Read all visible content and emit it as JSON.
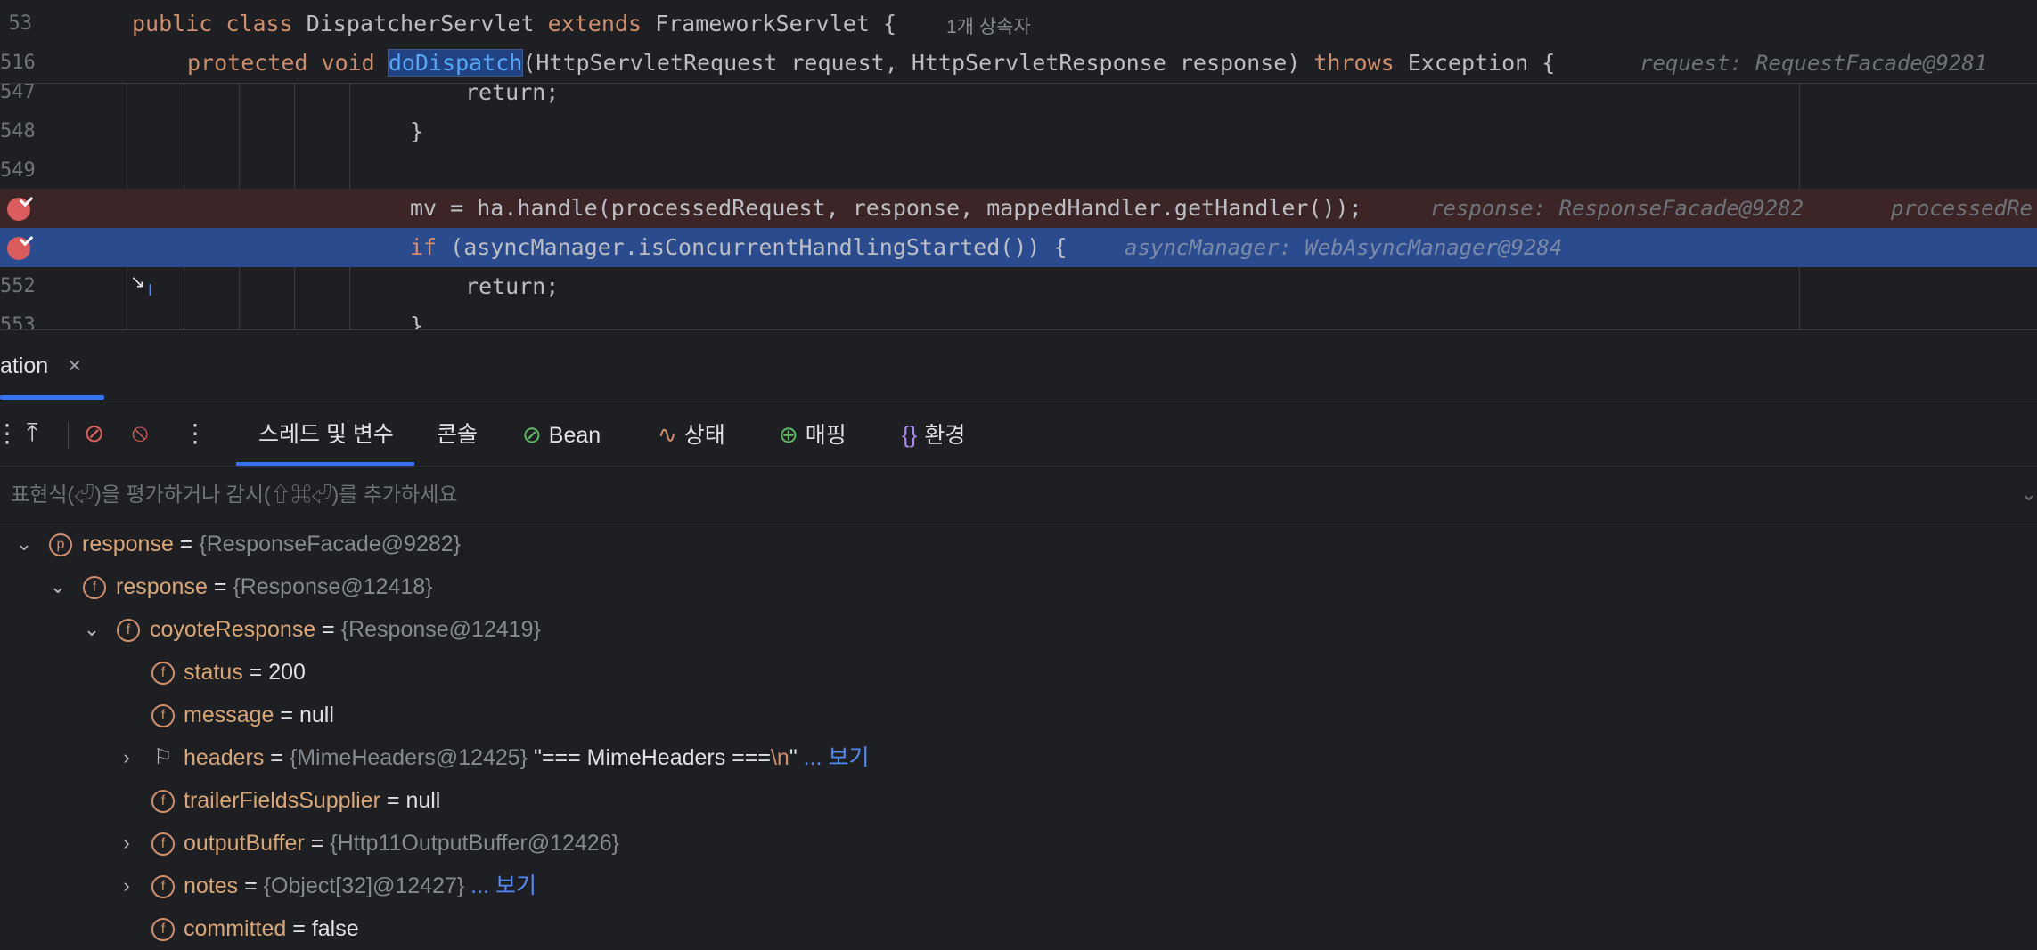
{
  "editor": {
    "sticky1": {
      "line_no": "53",
      "kw1": "public",
      "kw2": "class",
      "cls": "DispatcherServlet",
      "kw3": "extends",
      "parent": "FrameworkServlet",
      "brace": "{",
      "inheritors": "1개 상속자"
    },
    "sticky2": {
      "line_no": "516",
      "kw1": "protected",
      "kw2": "void",
      "method": "doDispatch",
      "params": "(HttpServletRequest request, HttpServletResponse response)",
      "kw3": "throws",
      "exc": "Exception {",
      "hint": "request: RequestFacade@9281"
    },
    "lines": [
      {
        "no": "547",
        "code": "return;"
      },
      {
        "no": "548",
        "code": "}"
      },
      {
        "no": "549",
        "code": ""
      },
      {
        "no": "",
        "code": "mv = ha.handle(processedRequest, response, mappedHandler.getHandler());",
        "hint": "response: ResponseFacade@9282",
        "hint2": "processedRe"
      },
      {
        "no": "",
        "code_kw": "if",
        "code": " (asyncManager.isConcurrentHandlingStarted()) {",
        "hint": "asyncManager: WebAsyncManager@9284"
      },
      {
        "no": "552",
        "code": "return;"
      },
      {
        "no": "553",
        "code": "}"
      }
    ]
  },
  "debug": {
    "run_tab": {
      "label": "ation",
      "close": "×"
    },
    "tabs": [
      {
        "label": "스레드 및 변수",
        "icon": ""
      },
      {
        "label": "콘솔",
        "icon": ""
      },
      {
        "label": "Bean",
        "icon": "bean-icon"
      },
      {
        "label": "상태",
        "icon": "health-icon"
      },
      {
        "label": "매핑",
        "icon": "mapping-icon"
      },
      {
        "label": "환경",
        "icon": "environment-icon"
      }
    ],
    "eval_placeholder": "표현식(⏎)을 평가하거나 감시(⇧⌘⏎)를 추가하세요",
    "variables": [
      {
        "name": "response",
        "eq": " = ",
        "type": "{ResponseFacade@9282}",
        "badge": "p",
        "expanded": true,
        "depth": 0
      },
      {
        "name": "response",
        "eq": " = ",
        "type": "{Response@12418}",
        "badge": "f",
        "expanded": true,
        "depth": 1
      },
      {
        "name": "coyoteResponse",
        "eq": " = ",
        "type": "{Response@12419}",
        "badge": "f",
        "expanded": true,
        "depth": 2
      },
      {
        "name": "status",
        "eq": " = ",
        "value": "200",
        "badge": "f",
        "depth": 3
      },
      {
        "name": "message",
        "eq": " = ",
        "value": "null",
        "badge": "f",
        "depth": 3
      },
      {
        "name": "headers",
        "eq": " = ",
        "type": "{MimeHeaders@12425}",
        "str1": " \"=== MimeHeaders ===",
        "esc": "\\n",
        "str2": "\"",
        "link": " ... 보기",
        "badge": "flag",
        "collapsed": true,
        "depth": 3
      },
      {
        "name": "trailerFieldsSupplier",
        "eq": " = ",
        "value": "null",
        "badge": "f",
        "depth": 3
      },
      {
        "name": "outputBuffer",
        "eq": " = ",
        "type": "{Http11OutputBuffer@12426}",
        "badge": "f",
        "collapsed": true,
        "depth": 3
      },
      {
        "name": "notes",
        "eq": " = ",
        "type": "{Object[32]@12427}",
        "link": " ... 보기",
        "badge": "f",
        "collapsed": true,
        "depth": 3
      },
      {
        "name": "committed",
        "eq": " = ",
        "value": "false",
        "badge": "f",
        "depth": 3
      }
    ]
  }
}
